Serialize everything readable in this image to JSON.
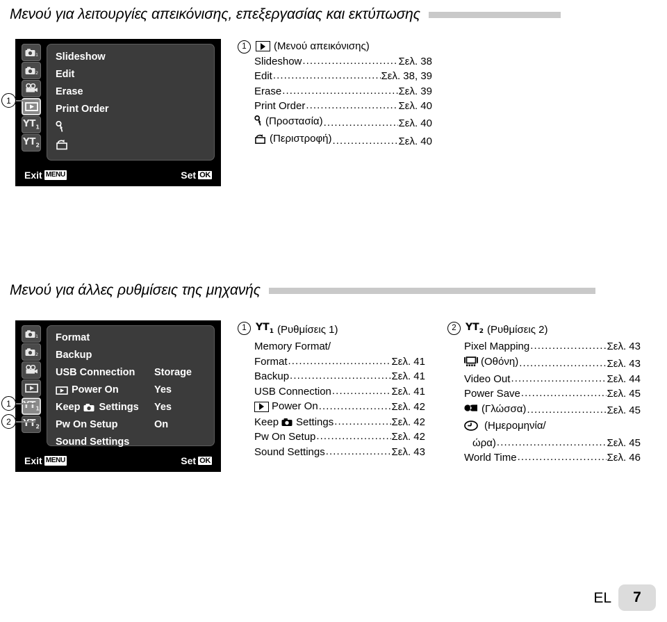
{
  "sections": [
    {
      "title": "Μενού για λειτουργίες απεικόνισης, επεξεργασίας και εκτύπωσης",
      "panel": {
        "tabs": [
          {
            "name": "camera1-tab",
            "icon": "camera-1-icon",
            "selected": false
          },
          {
            "name": "camera2-tab",
            "icon": "camera-2-icon",
            "selected": false
          },
          {
            "name": "movie-tab",
            "icon": "movie-camera-icon",
            "selected": false
          },
          {
            "name": "playback-tab",
            "icon": "playback-icon",
            "selected": true
          },
          {
            "name": "setup1-tab",
            "icon": "wrench-1-icon",
            "selected": false
          },
          {
            "name": "setup2-tab",
            "icon": "wrench-2-icon",
            "selected": false
          }
        ],
        "rows": [
          {
            "label": "Slideshow",
            "value": "",
            "icon": ""
          },
          {
            "label": "Edit",
            "value": "",
            "icon": ""
          },
          {
            "label": "Erase",
            "value": "",
            "icon": ""
          },
          {
            "label": "Print Order",
            "value": "",
            "icon": ""
          },
          {
            "label": "",
            "value": "",
            "icon": "key-protect-icon"
          },
          {
            "label": "",
            "value": "",
            "icon": "rotate-icon"
          }
        ],
        "exit_label": "Exit",
        "exit_key": "MENU",
        "set_label": "Set",
        "set_key": "OK"
      },
      "callouts": [
        {
          "number": "1",
          "target": "playback-tab"
        }
      ],
      "refcols": [
        {
          "number": "1",
          "head_icon": "playback-icon",
          "head_text": "(Μενού απεικόνισης)",
          "rows": [
            {
              "icon": "",
              "name": "Slideshow",
              "page": "Σελ. 38"
            },
            {
              "icon": "",
              "name": "Edit",
              "page": "Σελ. 38, 39"
            },
            {
              "icon": "",
              "name": "Erase",
              "page": "Σελ. 39"
            },
            {
              "icon": "",
              "name": "Print Order",
              "page": "Σελ. 40"
            },
            {
              "icon": "key-protect-icon",
              "name": "(Προστασία)",
              "page": "Σελ. 40"
            },
            {
              "icon": "rotate-icon",
              "name": "(Περιστροφή)",
              "page": "Σελ. 40"
            }
          ]
        }
      ]
    },
    {
      "title": "Μενού για άλλες ρυθμίσεις της μηχανής",
      "panel": {
        "tabs": [
          {
            "name": "camera1-tab",
            "icon": "camera-1-icon",
            "selected": false
          },
          {
            "name": "camera2-tab",
            "icon": "camera-2-icon",
            "selected": false
          },
          {
            "name": "movie-tab",
            "icon": "movie-camera-icon",
            "selected": false
          },
          {
            "name": "playback-tab",
            "icon": "playback-icon",
            "selected": false
          },
          {
            "name": "setup1-tab",
            "icon": "wrench-1-icon",
            "selected": true
          },
          {
            "name": "setup2-tab",
            "icon": "wrench-2-icon",
            "selected": false
          }
        ],
        "rows": [
          {
            "label": "Format",
            "value": "",
            "icon": ""
          },
          {
            "label": "Backup",
            "value": "",
            "icon": ""
          },
          {
            "label": "USB Connection",
            "value": "Storage",
            "icon": ""
          },
          {
            "label": "Power On",
            "value": "Yes",
            "icon": "playback-icon"
          },
          {
            "label": "Keep ◼ Settings",
            "value": "Yes",
            "icon": "camera-inline-icon"
          },
          {
            "label": "Pw On Setup",
            "value": "On",
            "icon": ""
          },
          {
            "label": "Sound Settings",
            "value": "",
            "icon": ""
          }
        ],
        "exit_label": "Exit",
        "exit_key": "MENU",
        "set_label": "Set",
        "set_key": "OK"
      },
      "callouts": [
        {
          "number": "1",
          "target": "setup1-tab"
        },
        {
          "number": "2",
          "target": "setup2-tab"
        }
      ],
      "refcols": [
        {
          "number": "1",
          "head_icon": "wrench-1-icon",
          "head_text": "(Ρυθμίσεις 1)",
          "rows": [
            {
              "icon": "",
              "name": "Memory Format/",
              "page": "",
              "nodots": true
            },
            {
              "icon": "",
              "name": "Format",
              "page": "Σελ. 41"
            },
            {
              "icon": "",
              "name": "Backup",
              "page": "Σελ. 41"
            },
            {
              "icon": "",
              "name": "USB Connection",
              "page": "Σελ. 41"
            },
            {
              "icon": "playback-icon",
              "name": "Power On",
              "page": "Σελ. 42"
            },
            {
              "icon": "camera-inline-icon",
              "name": "Keep ◼ Settings",
              "page": "Σελ. 42"
            },
            {
              "icon": "",
              "name": "Pw On Setup",
              "page": "Σελ. 42"
            },
            {
              "icon": "",
              "name": "Sound Settings",
              "page": "Σελ. 43"
            }
          ]
        },
        {
          "number": "2",
          "head_icon": "wrench-2-icon",
          "head_text": "(Ρυθμίσεις 2)",
          "rows": [
            {
              "icon": "",
              "name": "Pixel Mapping",
              "page": "Σελ. 43"
            },
            {
              "icon": "monitor-icon",
              "name": "(Οθόνη)",
              "page": "Σελ. 43"
            },
            {
              "icon": "",
              "name": "Video Out",
              "page": "Σελ. 44"
            },
            {
              "icon": "",
              "name": "Power Save",
              "page": "Σελ. 45"
            },
            {
              "icon": "language-icon",
              "name": "(Γλώσσα)",
              "page": "Σελ. 45"
            },
            {
              "icon": "clock-icon",
              "name": "(Ημερομηνία/",
              "page": "",
              "nodots": true
            },
            {
              "icon": "",
              "name": "ώρα)",
              "page": "Σελ. 45",
              "indent": true
            },
            {
              "icon": "",
              "name": "World Time",
              "page": "Σελ. 46"
            }
          ]
        }
      ]
    }
  ],
  "footer": {
    "lang_code": "EL",
    "page_number": "7"
  },
  "colors": {
    "rule": "#c9c9c9",
    "lcd_bg": "#000000",
    "list_bg": "#3b3b3b",
    "tab_bg": "#4a4a4a",
    "tab_selected_bg": "#8a8a8a",
    "footer_box": "#dcdcdc"
  },
  "dots": "......................................"
}
